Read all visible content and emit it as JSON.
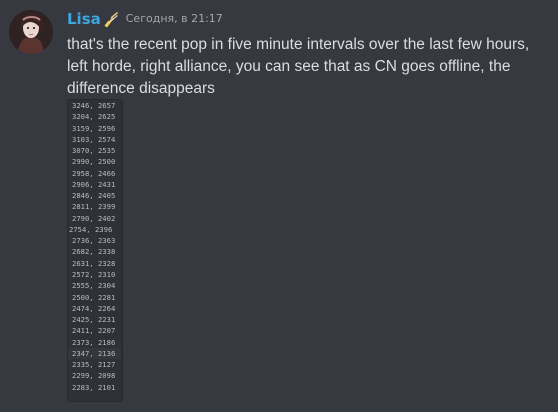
{
  "message": {
    "username": "Lisa",
    "badge_icon": "broom-icon",
    "timestamp": "Сегодня, в 21:17",
    "text": "that's the recent pop in five minute intervals over the last few hours, left horde, right alliance, you can see that as CN goes offline, the difference disappears",
    "code_rows": [
      "3246, 2657",
      "3204, 2625",
      "3159, 2596",
      "3103, 2574",
      "3070, 2535",
      "2990, 2500",
      "2958, 2466",
      "2906, 2431",
      "2846, 2405",
      "2811, 2399",
      "2790, 2402",
      "2754, 2396",
      "2736, 2363",
      "2682, 2338",
      "2631, 2328",
      "2572, 2310",
      "2555, 2304",
      "2500, 2281",
      "2474, 2264",
      "2425, 2231",
      "2411, 2207",
      "2373, 2186",
      "2347, 2136",
      "2335, 2127",
      "2299, 2098",
      "2283, 2101"
    ]
  },
  "colors": {
    "background": "#36393f",
    "username": "#3ea6e0",
    "text": "#dcddde",
    "timestamp": "#a3a6aa",
    "code_background": "#2f3136"
  }
}
